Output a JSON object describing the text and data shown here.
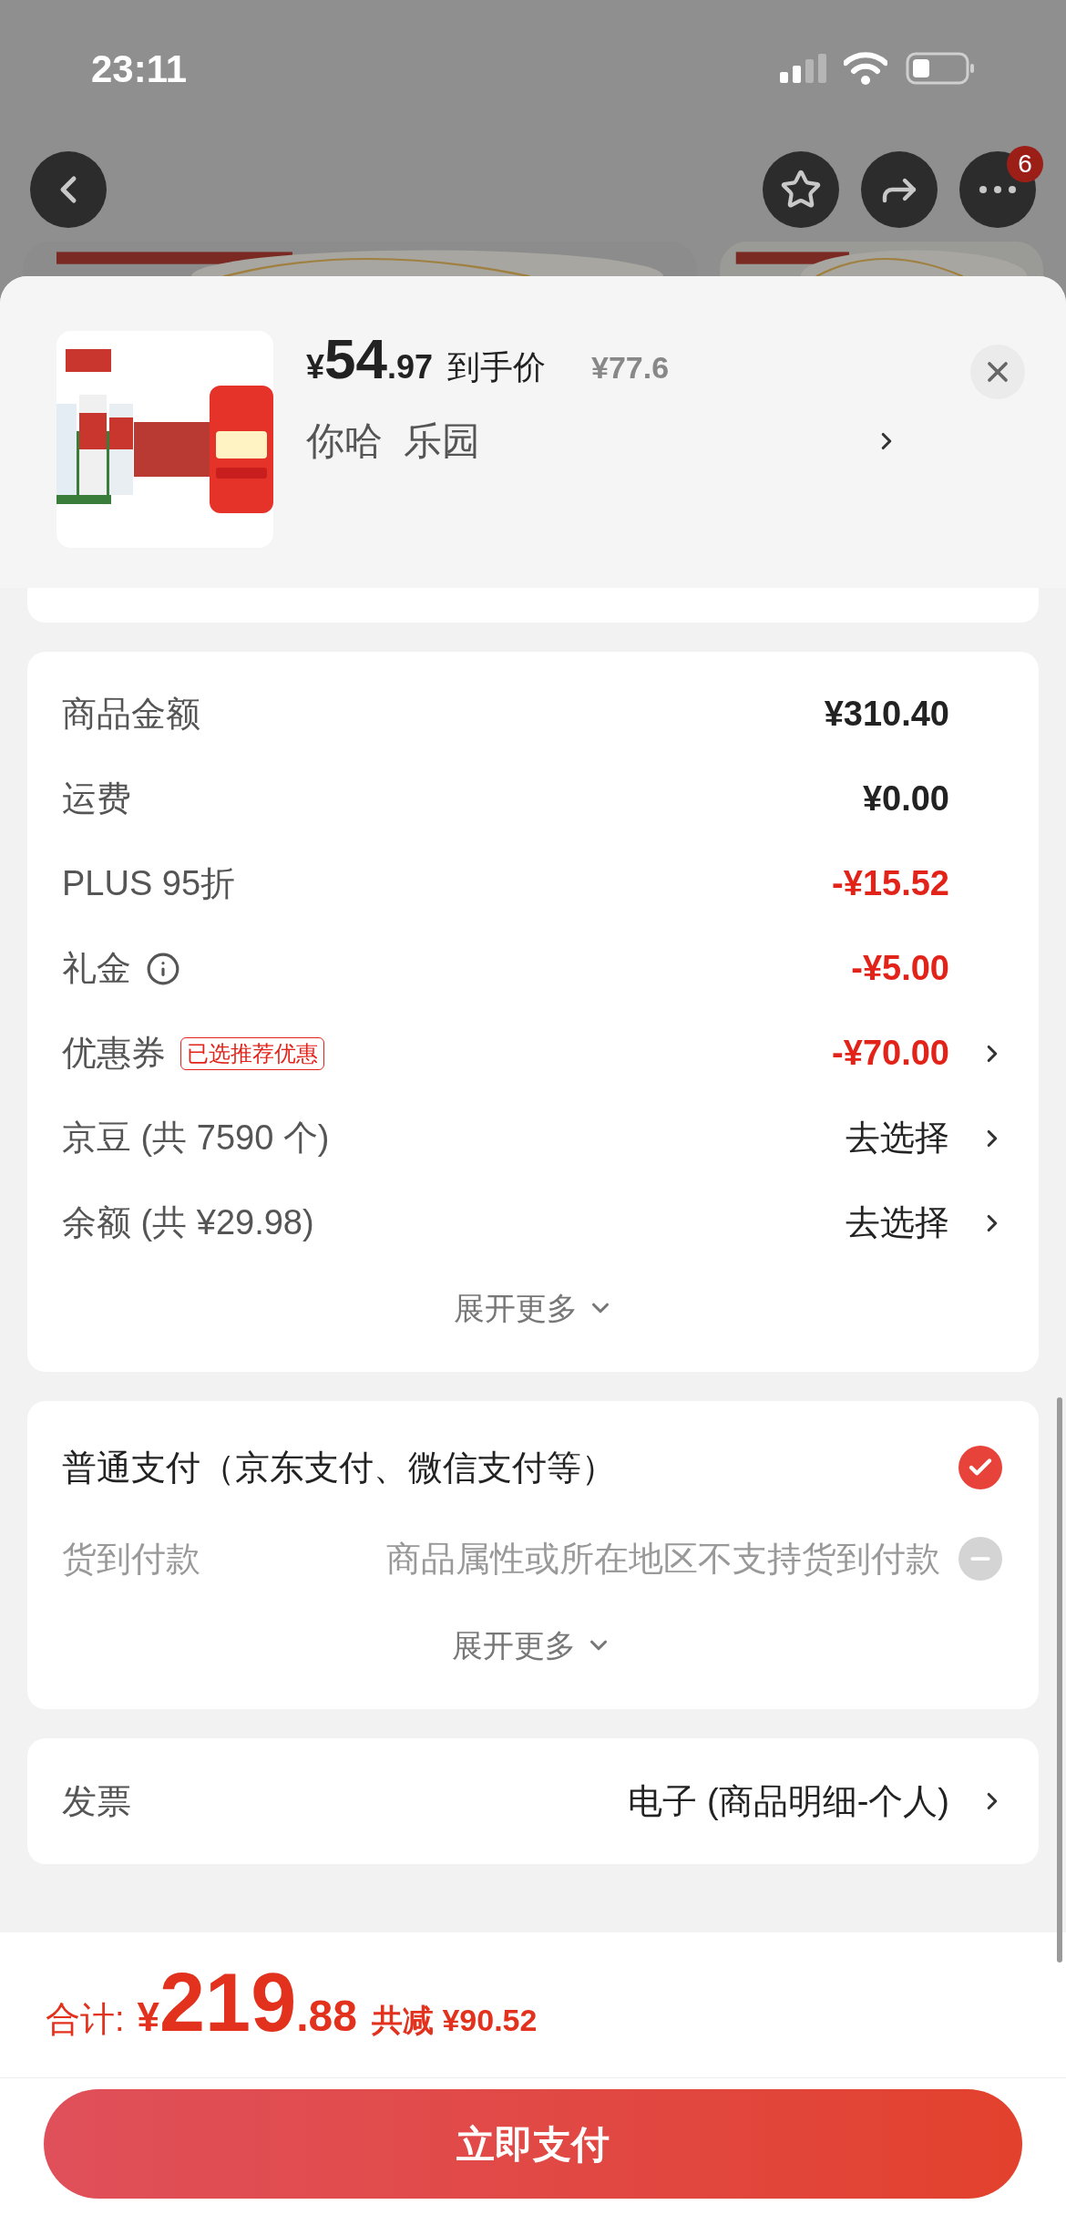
{
  "status_bar": {
    "time": "23:11"
  },
  "nav": {
    "more_badge": "6"
  },
  "product": {
    "currency": "¥",
    "price_int": "54",
    "price_dec": ".97",
    "price_label": "到手价",
    "original_price": "¥77.6",
    "spec": "你哈  乐园"
  },
  "amounts": [
    {
      "kind": "plain",
      "label": "商品金额",
      "value": "¥310.40",
      "discount": false,
      "chevron": false
    },
    {
      "kind": "plain",
      "label": "运费",
      "value": "¥0.00",
      "discount": false,
      "chevron": false
    },
    {
      "kind": "plain",
      "label": "PLUS 95折",
      "value": "-¥15.52",
      "discount": true,
      "chevron": false
    },
    {
      "kind": "info",
      "label": "礼金",
      "value": "-¥5.00",
      "discount": true,
      "chevron": false
    },
    {
      "kind": "tag",
      "label": "优惠券",
      "tag": "已选推荐优惠",
      "value": "-¥70.00",
      "discount": true,
      "chevron": true
    },
    {
      "kind": "plain",
      "label": "京豆 (共 7590 个)",
      "value": "去选择",
      "discount": false,
      "chevron": true
    },
    {
      "kind": "plain",
      "label": "余额 (共 ¥29.98)",
      "value": "去选择",
      "discount": false,
      "chevron": true
    }
  ],
  "amounts_expand": "展开更多",
  "payments": [
    {
      "label": "普通支付（京东支付、微信支付等）",
      "selected": true,
      "disabled": false
    },
    {
      "label": "货到付款",
      "note": "商品属性或所在地区不支持货到付款",
      "selected": false,
      "disabled": true
    }
  ],
  "payments_expand": "展开更多",
  "invoice": {
    "label": "发票",
    "value": "电子 (商品明细-个人)"
  },
  "footer": {
    "total_label": "合计:",
    "currency": "¥",
    "total_int": "219",
    "total_dec": ".88",
    "saving": "共减 ¥90.52",
    "pay_button": "立即支付"
  }
}
